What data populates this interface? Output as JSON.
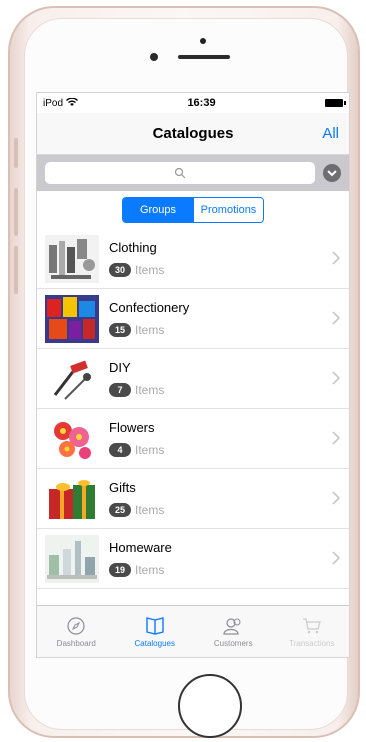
{
  "status_bar": {
    "carrier": "iPod",
    "time": "16:39"
  },
  "nav": {
    "title": "Catalogues",
    "right_button": "All"
  },
  "segments": {
    "groups": "Groups",
    "promotions": "Promotions"
  },
  "catalogues": [
    {
      "name": "Clothing",
      "count": "30",
      "items_label": "Items",
      "thumb": "clothing"
    },
    {
      "name": "Confectionery",
      "count": "15",
      "items_label": "Items",
      "thumb": "confectionery"
    },
    {
      "name": "DIY",
      "count": "7",
      "items_label": "Items",
      "thumb": "diy"
    },
    {
      "name": "Flowers",
      "count": "4",
      "items_label": "Items",
      "thumb": "flowers"
    },
    {
      "name": "Gifts",
      "count": "25",
      "items_label": "Items",
      "thumb": "gifts"
    },
    {
      "name": "Homeware",
      "count": "19",
      "items_label": "Items",
      "thumb": "homeware"
    }
  ],
  "tabs": {
    "dashboard": "Dashboard",
    "catalogues": "Catalogues",
    "customers": "Customers",
    "transactions": "Transactions"
  },
  "colors": {
    "accent": "#0a7aff",
    "badge": "#4a4a4a",
    "phone_frame": "#e9d5cf"
  }
}
